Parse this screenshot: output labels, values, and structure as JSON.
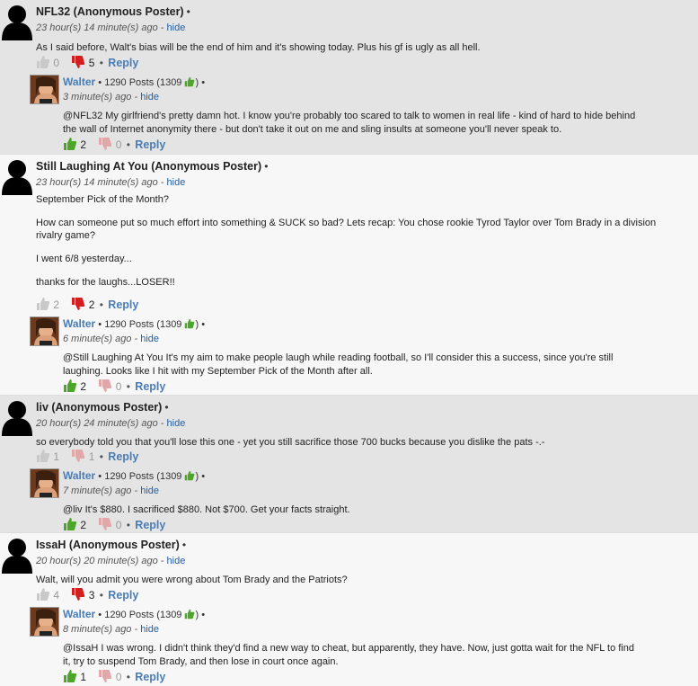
{
  "icons": {
    "anon_avatar": "anonymous-avatar-icon",
    "thumb_up": "thumbs-up-icon",
    "thumb_down": "thumbs-down-icon",
    "user_photo": "user-photo-avatar"
  },
  "colors": {
    "up_active": "#4ca627",
    "down_active": "#d21e1e",
    "inactive": "#c9c9c9",
    "link": "#4a7db5"
  },
  "comments": [
    {
      "author": "NFL32 (Anonymous Poster)",
      "dot": "•",
      "time": "23 hour(s) 14 minute(s) ago",
      "dash": " - ",
      "hide": "hide",
      "body": [
        "As I said before, Walt's bias will be the end of him and it's showing today.  Plus his gf is ugly as all hell."
      ],
      "up": "0",
      "down": "5",
      "reply": "Reply",
      "sep": "•",
      "reply_comment": {
        "author": "Walter",
        "posts": " • 1290 Posts (1309 ",
        "posts_end": ") •",
        "time": "3 minute(s) ago",
        "hide": "hide",
        "lines": [
          "@NFL32 My girlfriend's pretty damn hot. I know you're probably too scared to talk to women in real life - kind of hard to hide behind",
          "the wall of Internet anonymity there - but don't take it out on me and sling insults at someone you'll never speak to."
        ],
        "up": "2",
        "down": "0",
        "reply": "Reply"
      }
    },
    {
      "author": "Still Laughing At You (Anonymous Poster)",
      "dot": "•",
      "time": "23 hour(s) 14 minute(s) ago",
      "dash": " - ",
      "hide": "hide",
      "body": [
        "September Pick of the Month?",
        "How can someone put so much effort into something & SUCK so bad? Lets recap: You chose rookie Tyrod Taylor over Tom Brady in a division rivalry game?",
        "I went 6/8 yesterday...",
        "thanks for the laughs...LOSER!!"
      ],
      "up": "2",
      "down": "2",
      "reply": "Reply",
      "sep": "•",
      "reply_comment": {
        "author": "Walter",
        "posts": " • 1290 Posts (1309 ",
        "posts_end": ") •",
        "time": "6 minute(s) ago",
        "hide": "hide",
        "lines": [
          "@Still Laughing At You It's my aim to make people laugh while reading football, so I'll consider this a success, since you're still",
          "laughing. Looks like I hit with my September Pick of the Month after all."
        ],
        "up": "2",
        "down": "0",
        "reply": "Reply"
      }
    },
    {
      "author": "liv (Anonymous Poster)",
      "dot": "•",
      "time": "20 hour(s) 24 minute(s) ago",
      "dash": " - ",
      "hide": "hide",
      "body": [
        "so everybody told you that you'll lose this one - yet you still sacrifice those 700 bucks because you dislike the pats -.-"
      ],
      "up": "1",
      "down": "1",
      "reply": "Reply",
      "sep": "•",
      "reply_comment": {
        "author": "Walter",
        "posts": " • 1290 Posts (1309 ",
        "posts_end": ") •",
        "time": "7 minute(s) ago",
        "hide": "hide",
        "lines": [
          "@liv  It's $880. I sacrificed $880. Not $700. Get your facts straight."
        ],
        "up": "2",
        "down": "0",
        "reply": "Reply"
      }
    },
    {
      "author": "IssaH (Anonymous Poster)",
      "dot": "•",
      "time": "20 hour(s) 20 minute(s) ago",
      "dash": " - ",
      "hide": "hide",
      "body": [
        "Walt, will you admit you were wrong about Tom Brady and the Patriots?"
      ],
      "up": "4",
      "down": "3",
      "reply": "Reply",
      "sep": "•",
      "reply_comment": {
        "author": "Walter",
        "posts": " • 1290 Posts (1309 ",
        "posts_end": ") •",
        "time": "8 minute(s) ago",
        "hide": "hide",
        "lines": [
          "@IssaH I was wrong. I didn't think they'd find a new way to cheat, but apparently, they have. Now, just gotta wait for the NFL to find",
          "it, try to suspend Tom Brady, and then lose in court once again."
        ],
        "up": "1",
        "down": "0",
        "reply": "Reply"
      }
    }
  ]
}
